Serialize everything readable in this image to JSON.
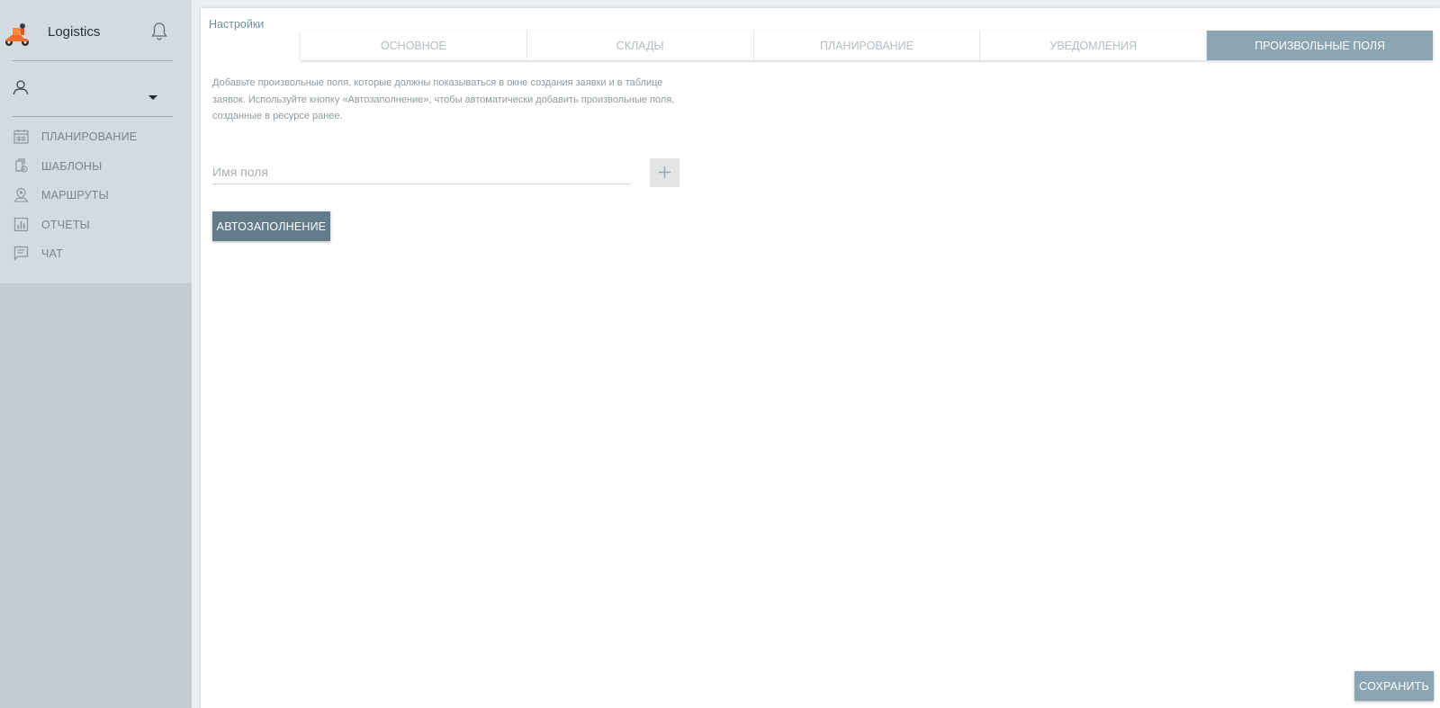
{
  "brand": {
    "name": "Logistics",
    "logo_icon": "courier-scooter-icon"
  },
  "sidebar": {
    "items": [
      {
        "label": "ПЛАНИРОВАНИЕ",
        "icon": "calendar-icon"
      },
      {
        "label": "ШАБЛОНЫ",
        "icon": "templates-icon"
      },
      {
        "label": "МАРШРУТЫ",
        "icon": "map-pin-icon"
      },
      {
        "label": "ОТЧЕТЫ",
        "icon": "bar-chart-icon"
      },
      {
        "label": "ЧАТ",
        "icon": "chat-icon"
      }
    ]
  },
  "main": {
    "title": "Настройки",
    "tabs": [
      {
        "label": "ОСНОВНОЕ"
      },
      {
        "label": "СКЛАДЫ"
      },
      {
        "label": "ПЛАНИРОВАНИЕ"
      },
      {
        "label": "УВЕДОМЛЕНИЯ"
      },
      {
        "label": "ПРОИЗВОЛЬНЫЕ ПОЛЯ"
      }
    ],
    "active_tab": "ПРОИЗВОЛЬНЫЕ ПОЛЯ",
    "description": "Добавьте произвольные поля, которые должны показываться в окне создания заявки и в таблице заявок. Используйте кнопку «Автозаполнение», чтобы автоматически добавить произвольные поля, созданные в ресурсе ранее.",
    "field": {
      "placeholder": "Имя поля",
      "value": ""
    },
    "autofill_label": "АВТОЗАПОЛНЕНИЕ",
    "save_label": "СОХРАНИТЬ"
  },
  "colors": {
    "sidebar_top": "#d1dbe0",
    "sidebar_bottom": "#c3cdd1",
    "active_tab": "#8aa4b2",
    "autofill_button": "#627c8b",
    "accent_orange": "#f26b2a"
  }
}
